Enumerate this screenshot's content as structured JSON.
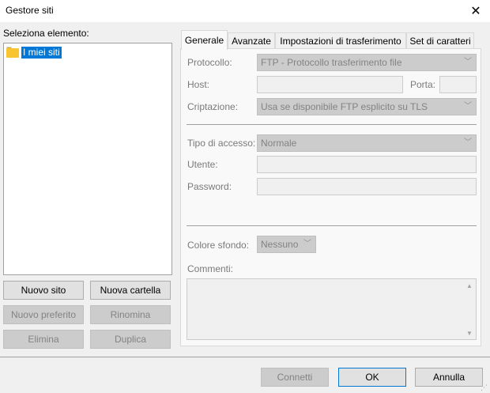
{
  "window": {
    "title": "Gestore siti",
    "close_glyph": "✕"
  },
  "left": {
    "select_label": "Seleziona elemento:",
    "tree": {
      "items": [
        {
          "label": "I miei siti",
          "icon": "folder-icon",
          "selected": true
        }
      ]
    },
    "buttons": {
      "new_site": "Nuovo sito",
      "new_folder": "Nuova cartella",
      "new_bookmark": "Nuovo preferito",
      "rename": "Rinomina",
      "delete": "Elimina",
      "duplicate": "Duplica"
    }
  },
  "tabs": [
    {
      "label": "Generale",
      "active": true
    },
    {
      "label": "Avanzate",
      "active": false
    },
    {
      "label": "Impostazioni di trasferimento",
      "active": false
    },
    {
      "label": "Set di caratteri",
      "active": false
    }
  ],
  "general": {
    "protocol_label": "Protocollo:",
    "protocol_value": "FTP - Protocollo trasferimento file",
    "host_label": "Host:",
    "host_value": "",
    "port_label": "Porta:",
    "port_value": "",
    "encryption_label": "Criptazione:",
    "encryption_value": "Usa se disponibile FTP esplicito su TLS",
    "logon_label": "Tipo di accesso:",
    "logon_value": "Normale",
    "user_label": "Utente:",
    "user_value": "",
    "password_label": "Password:",
    "password_value": "",
    "bgcolor_label": "Colore sfondo:",
    "bgcolor_value": "Nessuno",
    "comments_label": "Commenti:",
    "comments_value": ""
  },
  "footer": {
    "connect": "Connetti",
    "ok": "OK",
    "cancel": "Annulla"
  },
  "glyphs": {
    "dropdown_arrow": "﹀",
    "scroll_up": "▲",
    "scroll_down": "▼",
    "grip": "⋰"
  },
  "colors": {
    "selection": "#0078d7",
    "window_bg": "#f0f0f0",
    "disabled_bg": "#cccccc",
    "folder": "#f8c431"
  }
}
